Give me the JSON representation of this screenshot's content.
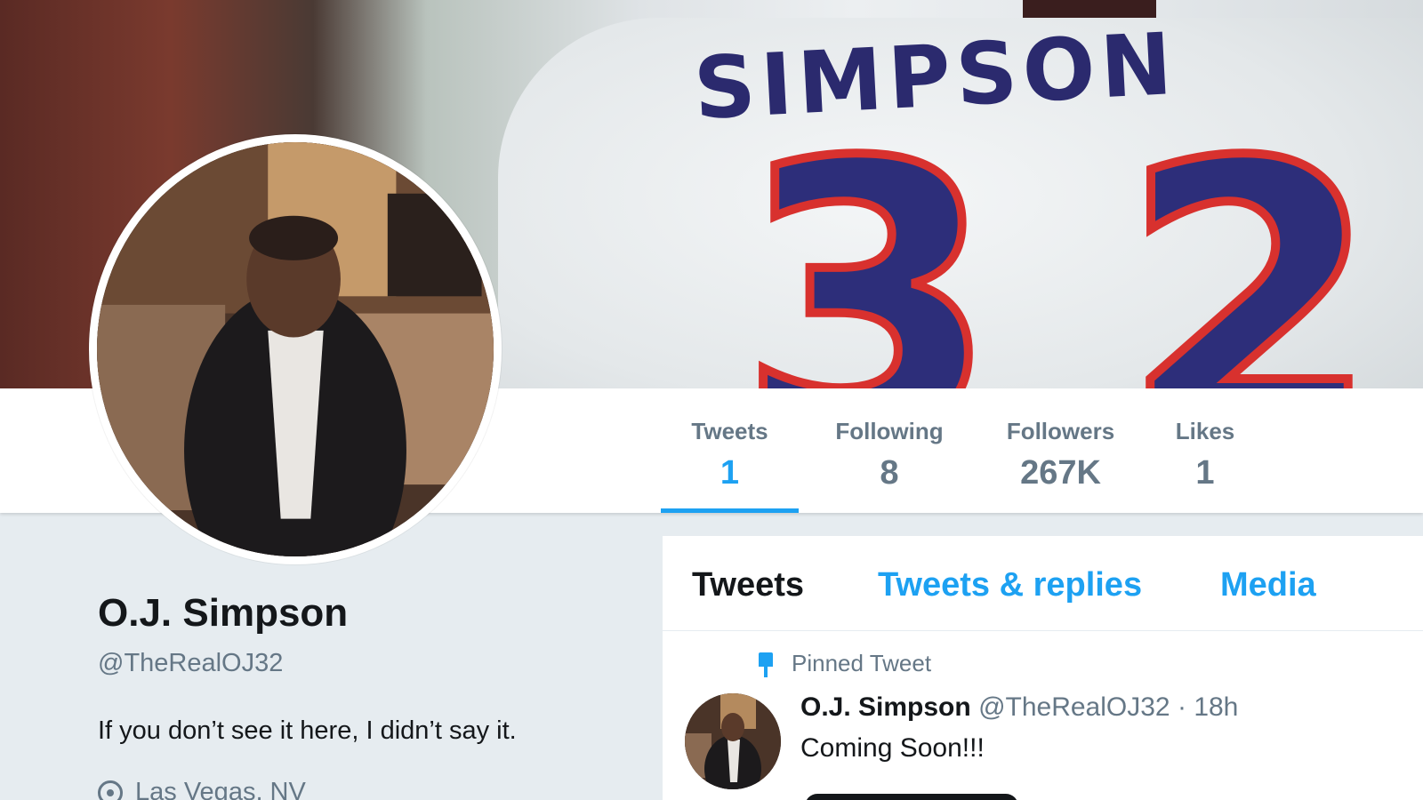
{
  "profile": {
    "name": "O.J. Simpson",
    "handle": "@TheRealOJ32",
    "bio": "If you don’t see it here, I didn’t say it.",
    "location": "Las Vegas, NV"
  },
  "banner": {
    "jersey_name": "SIMPSON",
    "jersey_number": "32"
  },
  "stats": [
    {
      "label": "Tweets",
      "value": "1",
      "active": true
    },
    {
      "label": "Following",
      "value": "8",
      "active": false
    },
    {
      "label": "Followers",
      "value": "267K",
      "active": false
    },
    {
      "label": "Likes",
      "value": "1",
      "active": false
    }
  ],
  "timeline": {
    "tabs": [
      {
        "label": "Tweets",
        "active": true
      },
      {
        "label": "Tweets & replies",
        "active": false
      },
      {
        "label": "Media",
        "active": false
      }
    ],
    "pinned_label": "Pinned Tweet",
    "tweet": {
      "name": "O.J. Simpson",
      "handle": "@TheRealOJ32",
      "separator": "·",
      "time": "18h",
      "text": "Coming Soon!!!"
    }
  },
  "colors": {
    "accent": "#1da1f2",
    "secondary_text": "#657786",
    "primary_text": "#14171a",
    "background": "#e6ecf0"
  },
  "icons": {
    "pin": "pin-icon",
    "location": "location-icon"
  }
}
